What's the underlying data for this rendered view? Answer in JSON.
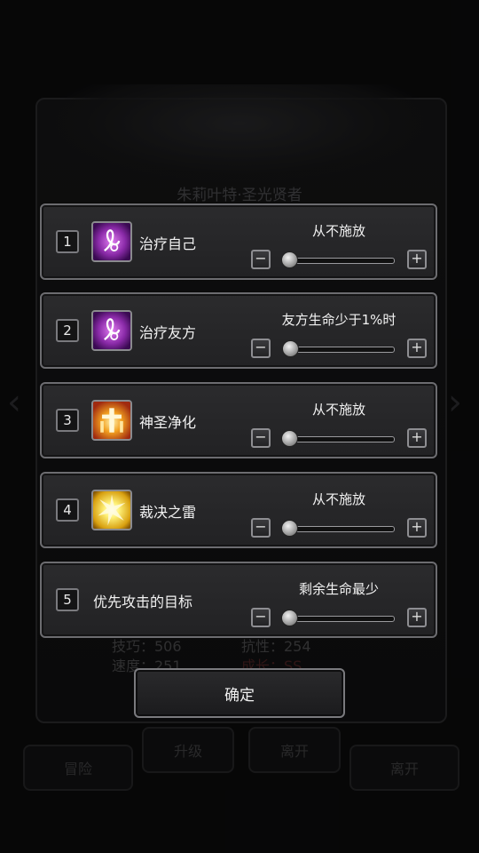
{
  "background": {
    "title": "朱莉叶特·圣光贤者",
    "stats": [
      {
        "text": "技巧：506"
      },
      {
        "text": "抗性：254"
      },
      {
        "text": "速度：251"
      },
      {
        "text": "成长：SS"
      }
    ],
    "buttons": {
      "upgrade": "升级",
      "leave": "离开",
      "adventure": "冒险",
      "leave_bottom": "离开"
    }
  },
  "rules": [
    {
      "number": "1",
      "skill": "治疗自己",
      "icon": "heal-rune-icon",
      "condition": "从不施放",
      "level": 0
    },
    {
      "number": "2",
      "skill": "治疗友方",
      "icon": "heal-rune-icon",
      "condition": "友方生命少于1%时",
      "level": 0.01
    },
    {
      "number": "3",
      "skill": "神圣净化",
      "icon": "holy-purify-icon",
      "condition": "从不施放",
      "level": 0
    },
    {
      "number": "4",
      "skill": "裁决之雷",
      "icon": "judgment-thunder-icon",
      "condition": "从不施放",
      "level": 0
    },
    {
      "number": "5",
      "skill": "优先攻击的目标",
      "icon": "",
      "condition": "剩余生命最少",
      "level": 0
    }
  ],
  "stepper": {
    "minus": "−",
    "plus": "+"
  },
  "confirm_label": "确定"
}
